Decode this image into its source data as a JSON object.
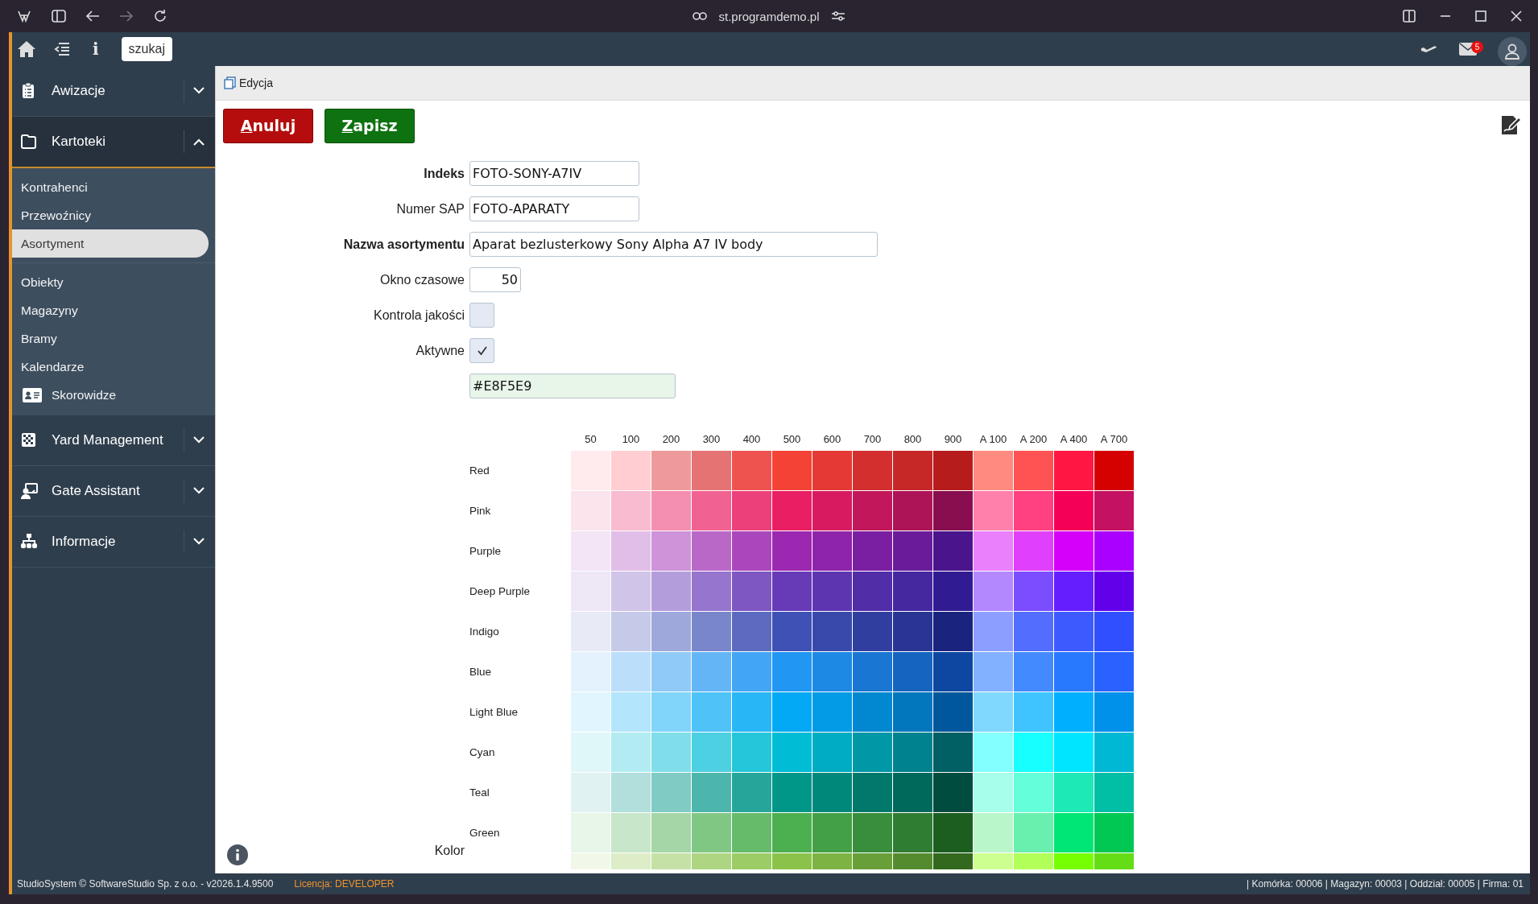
{
  "browser": {
    "url": "st.programdemo.pl"
  },
  "topbar": {
    "search_button": "szukaj",
    "info_button": "i",
    "mail_badge": "5"
  },
  "sidebar": {
    "sections": [
      {
        "label": "Awizacje",
        "expanded": false
      },
      {
        "label": "Kartoteki",
        "expanded": true,
        "groups": [
          [
            {
              "label": "Kontrahenci",
              "selected": false,
              "kind": "plain"
            },
            {
              "label": "Przewoźnicy",
              "selected": false,
              "kind": "plain"
            },
            {
              "label": "Asortyment",
              "selected": true,
              "kind": "plain"
            }
          ],
          [
            {
              "label": "Obiekty",
              "selected": false,
              "kind": "plain"
            },
            {
              "label": "Magazyny",
              "selected": false,
              "kind": "plain"
            },
            {
              "label": "Bramy",
              "selected": false,
              "kind": "plain"
            },
            {
              "label": "Kalendarze",
              "selected": false,
              "kind": "plain"
            },
            {
              "label": "Skorowidze",
              "selected": false,
              "kind": "icon"
            }
          ]
        ]
      },
      {
        "label": "Yard Management",
        "expanded": false
      },
      {
        "label": "Gate Assistant",
        "expanded": false
      },
      {
        "label": "Informacje",
        "expanded": false
      }
    ]
  },
  "breadcrumb": "Edycja",
  "toolbar": {
    "buttons": [
      {
        "label": "Anuluj",
        "kind": "cancel"
      },
      {
        "label": "Zapisz",
        "kind": "save"
      }
    ]
  },
  "form": {
    "fields": [
      {
        "label": "Indeks",
        "required": true,
        "kind": "text",
        "value": "FOTO-SONY-A7IV"
      },
      {
        "label": "Numer SAP",
        "required": false,
        "kind": "text",
        "value": "FOTO-APARATY"
      },
      {
        "label": "Nazwa asortymentu",
        "required": true,
        "kind": "wide",
        "value": "Aparat bezlusterkowy Sony Alpha A7 IV body"
      },
      {
        "label": "Okno czasowe",
        "required": false,
        "kind": "number",
        "value": "50"
      },
      {
        "label": "Kontrola jakości",
        "required": false,
        "kind": "checkbox",
        "checked": false
      },
      {
        "label": "Aktywne",
        "required": false,
        "kind": "checkbox",
        "checked": true
      },
      {
        "kind": "color",
        "value": "#E8F5E9"
      }
    ]
  },
  "palette": {
    "label": "Kolor",
    "columns": [
      "50",
      "100",
      "200",
      "300",
      "400",
      "500",
      "600",
      "700",
      "800",
      "900",
      "A 100",
      "A 200",
      "A 400",
      "A 700"
    ],
    "rows": [
      {
        "name": "Red",
        "swatches": [
          {
            "color": "#ffebee"
          },
          {
            "color": "#ffcdd2"
          },
          {
            "color": "#ef9a9a"
          },
          {
            "color": "#e57373"
          },
          {
            "color": "#ef5350"
          },
          {
            "color": "#f44336"
          },
          {
            "color": "#e53935"
          },
          {
            "color": "#d32f2f"
          },
          {
            "color": "#c62828"
          },
          {
            "color": "#b71c1c"
          },
          {
            "color": "#ff8a80"
          },
          {
            "color": "#ff5252"
          },
          {
            "color": "#ff1744"
          },
          {
            "color": "#d50000"
          }
        ]
      },
      {
        "name": "Pink",
        "swatches": [
          {
            "color": "#fce4ec"
          },
          {
            "color": "#f8bbd0"
          },
          {
            "color": "#f48fb1"
          },
          {
            "color": "#f06292"
          },
          {
            "color": "#ec407a"
          },
          {
            "color": "#e91e63"
          },
          {
            "color": "#d81b60"
          },
          {
            "color": "#c2185b"
          },
          {
            "color": "#ad1457"
          },
          {
            "color": "#880e4f"
          },
          {
            "color": "#ff80ab"
          },
          {
            "color": "#ff4081"
          },
          {
            "color": "#f50057"
          },
          {
            "color": "#c51162"
          }
        ]
      },
      {
        "name": "Purple",
        "swatches": [
          {
            "color": "#f3e5f5"
          },
          {
            "color": "#e1bee7"
          },
          {
            "color": "#ce93d8"
          },
          {
            "color": "#ba68c8"
          },
          {
            "color": "#ab47bc"
          },
          {
            "color": "#9c27b0"
          },
          {
            "color": "#8e24aa"
          },
          {
            "color": "#7b1fa2"
          },
          {
            "color": "#6a1b9a"
          },
          {
            "color": "#4a148c"
          },
          {
            "color": "#ea80fc"
          },
          {
            "color": "#e040fb"
          },
          {
            "color": "#d500f9"
          },
          {
            "color": "#aa00ff"
          }
        ]
      },
      {
        "name": "Deep Purple",
        "swatches": [
          {
            "color": "#ede7f6"
          },
          {
            "color": "#d1c4e9"
          },
          {
            "color": "#b39ddb"
          },
          {
            "color": "#9575cd"
          },
          {
            "color": "#7e57c2"
          },
          {
            "color": "#673ab7"
          },
          {
            "color": "#5e35b1"
          },
          {
            "color": "#512da8"
          },
          {
            "color": "#4527a0"
          },
          {
            "color": "#311b92"
          },
          {
            "color": "#b388ff"
          },
          {
            "color": "#7c4dff"
          },
          {
            "color": "#651fff"
          },
          {
            "color": "#6200ea"
          }
        ]
      },
      {
        "name": "Indigo",
        "swatches": [
          {
            "color": "#e8eaf6"
          },
          {
            "color": "#c5cae9"
          },
          {
            "color": "#9fa8da"
          },
          {
            "color": "#7986cb"
          },
          {
            "color": "#5c6bc0"
          },
          {
            "color": "#3f51b5"
          },
          {
            "color": "#3949ab"
          },
          {
            "color": "#303f9f"
          },
          {
            "color": "#283593"
          },
          {
            "color": "#1a237e"
          },
          {
            "color": "#8c9eff"
          },
          {
            "color": "#536dfe"
          },
          {
            "color": "#3d5afe"
          },
          {
            "color": "#304ffe"
          }
        ]
      },
      {
        "name": "Blue",
        "swatches": [
          {
            "color": "#e3f2fd"
          },
          {
            "color": "#bbdefb"
          },
          {
            "color": "#90caf9"
          },
          {
            "color": "#64b5f6"
          },
          {
            "color": "#42a5f5"
          },
          {
            "color": "#2196f3"
          },
          {
            "color": "#1e88e5"
          },
          {
            "color": "#1976d2"
          },
          {
            "color": "#1565c0"
          },
          {
            "color": "#0d47a1"
          },
          {
            "color": "#82b1ff"
          },
          {
            "color": "#448aff"
          },
          {
            "color": "#2979ff"
          },
          {
            "color": "#2962ff"
          }
        ]
      },
      {
        "name": "Light Blue",
        "swatches": [
          {
            "color": "#e1f5fe"
          },
          {
            "color": "#b3e5fc"
          },
          {
            "color": "#81d4fa"
          },
          {
            "color": "#4fc3f7"
          },
          {
            "color": "#29b6f6"
          },
          {
            "color": "#03a9f4"
          },
          {
            "color": "#039be5"
          },
          {
            "color": "#0288d1"
          },
          {
            "color": "#0277bd"
          },
          {
            "color": "#01579b"
          },
          {
            "color": "#80d8ff"
          },
          {
            "color": "#40c4ff"
          },
          {
            "color": "#00b0ff"
          },
          {
            "color": "#0091ea"
          }
        ]
      },
      {
        "name": "Cyan",
        "swatches": [
          {
            "color": "#e0f7fa"
          },
          {
            "color": "#b2ebf2"
          },
          {
            "color": "#80deea"
          },
          {
            "color": "#4dd0e1"
          },
          {
            "color": "#26c6da"
          },
          {
            "color": "#00bcd4"
          },
          {
            "color": "#00acc1"
          },
          {
            "color": "#0097a7"
          },
          {
            "color": "#00838f"
          },
          {
            "color": "#006064"
          },
          {
            "color": "#84ffff"
          },
          {
            "color": "#18ffff"
          },
          {
            "color": "#00e5ff"
          },
          {
            "color": "#00b8d4"
          }
        ]
      },
      {
        "name": "Teal",
        "swatches": [
          {
            "color": "#e0f2f1"
          },
          {
            "color": "#b2dfdb"
          },
          {
            "color": "#80cbc4"
          },
          {
            "color": "#4db6ac"
          },
          {
            "color": "#26a69a"
          },
          {
            "color": "#009688"
          },
          {
            "color": "#00897b"
          },
          {
            "color": "#00796b"
          },
          {
            "color": "#00695c"
          },
          {
            "color": "#004d40"
          },
          {
            "color": "#a7ffeb"
          },
          {
            "color": "#64ffda"
          },
          {
            "color": "#1de9b6"
          },
          {
            "color": "#00bfa5"
          }
        ]
      },
      {
        "name": "Green",
        "swatches": [
          {
            "color": "#e8f5e9"
          },
          {
            "color": "#c8e6c9"
          },
          {
            "color": "#a5d6a7"
          },
          {
            "color": "#81c784"
          },
          {
            "color": "#66bb6a"
          },
          {
            "color": "#4caf50"
          },
          {
            "color": "#43a047"
          },
          {
            "color": "#388e3c"
          },
          {
            "color": "#2e7d32"
          },
          {
            "color": "#1b5e20"
          },
          {
            "color": "#b9f6ca"
          },
          {
            "color": "#69f0ae"
          },
          {
            "color": "#00e676"
          },
          {
            "color": "#00c853"
          }
        ]
      },
      {
        "swatches": [
          {
            "color": "#f1f8e9"
          },
          {
            "color": "#dcedc8"
          },
          {
            "color": "#c5e1a5"
          },
          {
            "color": "#aed581"
          },
          {
            "color": "#9ccc65"
          },
          {
            "color": "#8bc34a"
          },
          {
            "color": "#7cb342"
          },
          {
            "color": "#689f38"
          },
          {
            "color": "#558b2f"
          },
          {
            "color": "#33691e"
          },
          {
            "color": "#ccff90"
          },
          {
            "color": "#b2ff59"
          },
          {
            "color": "#76ff03"
          },
          {
            "color": "#64dd17"
          }
        ]
      }
    ]
  },
  "status_bar": {
    "copyright": "StudioSystem © SoftwareStudio Sp. z o.o. - v2026.1.4.9500",
    "license": "Licencja: DEVELOPER",
    "info": "| Komórka: 00006 | Magazyn: 00003 | Oddział: 00005 | Firma: 01"
  }
}
